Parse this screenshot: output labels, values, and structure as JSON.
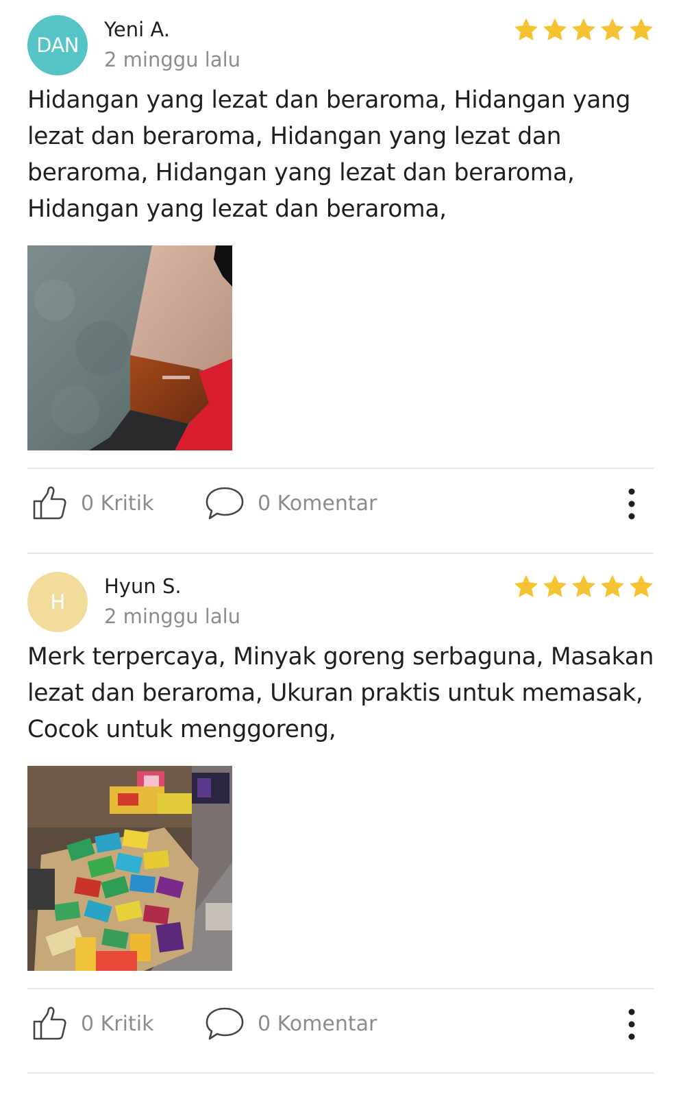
{
  "colors": {
    "star": "#f5c232",
    "avatar_teal": "#56c4c6",
    "avatar_yellow": "#f2dc9c",
    "muted_text": "#8c8c8c",
    "divider": "#e6e6e6"
  },
  "reviews": [
    {
      "avatar_initials": "DAN",
      "avatar_color": "#56c4c6",
      "name": "Yeni A.",
      "time": "2 minggu lalu",
      "rating": 5,
      "text": "Hidangan yang lezat dan beraroma, Hidangan yang lezat dan beraroma, Hidangan yang lezat dan beraroma, Hidangan yang lezat dan beraroma, Hidangan yang lezat dan beraroma,",
      "photo_icon": "review-photo",
      "like_label": "0 Kritik",
      "comment_label": "0 Komentar"
    },
    {
      "avatar_initials": "H",
      "avatar_color": "#f2dc9c",
      "name": "Hyun S.",
      "time": "2 minggu lalu",
      "rating": 5,
      "text": "Merk terpercaya, Minyak goreng serbaguna, Masakan lezat dan beraroma, Ukuran praktis untuk memasak, Cocok untuk menggoreng,",
      "photo_icon": "review-photo",
      "like_label": "0 Kritik",
      "comment_label": "0 Komentar"
    }
  ]
}
